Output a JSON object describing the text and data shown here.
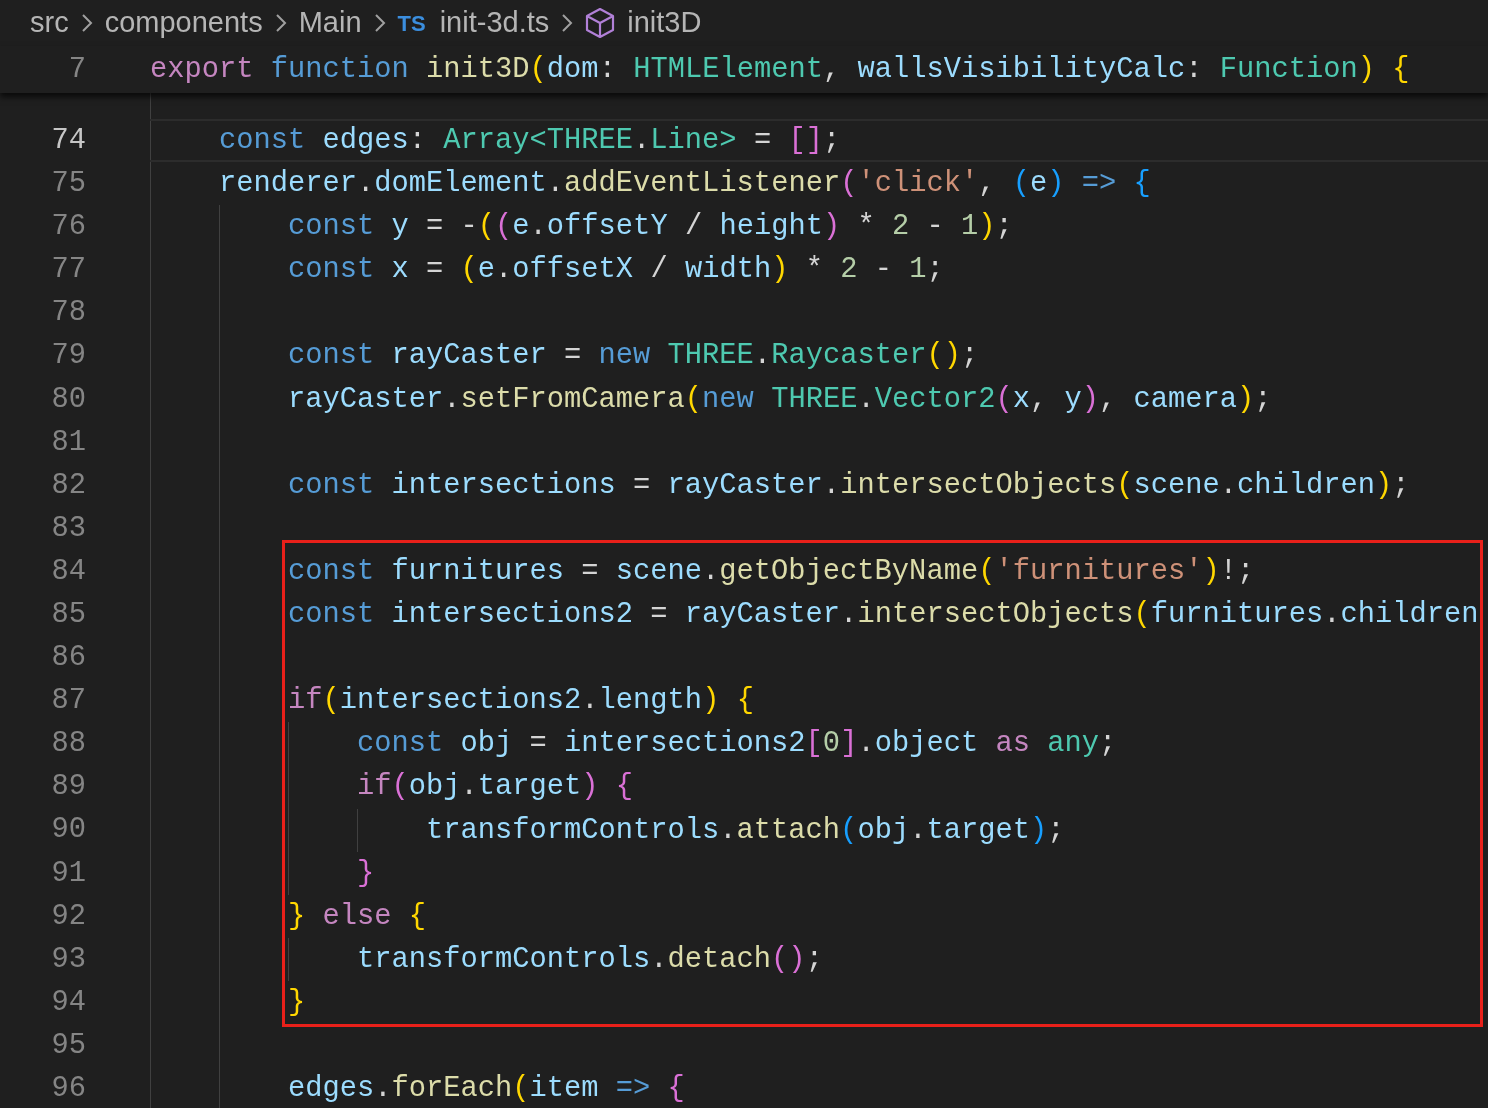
{
  "breadcrumb": [
    {
      "kind": "folder",
      "label": "src"
    },
    {
      "kind": "folder",
      "label": "components"
    },
    {
      "kind": "folder",
      "label": "Main"
    },
    {
      "kind": "ts-file",
      "badge": "TS",
      "label": "init-3d.ts"
    },
    {
      "kind": "symbol",
      "label": "init3D"
    }
  ],
  "sticky_line": {
    "number": "7",
    "tokens": [
      {
        "kind": "ctl",
        "text": "export"
      },
      {
        "kind": "kw",
        "text": " function"
      },
      {
        "kind": "fn",
        "text": " init3D"
      },
      {
        "kind": "b1",
        "text": "("
      },
      {
        "kind": "var",
        "text": "dom"
      },
      {
        "kind": "p",
        "text": ": "
      },
      {
        "kind": "type",
        "text": "HTMLElement"
      },
      {
        "kind": "p",
        "text": ", "
      },
      {
        "kind": "var",
        "text": "wallsVisibilityCalc"
      },
      {
        "kind": "p",
        "text": ": "
      },
      {
        "kind": "type",
        "text": "Function"
      },
      {
        "kind": "b1",
        "text": ")"
      },
      {
        "kind": "b1",
        "text": " {"
      }
    ]
  },
  "lines": [
    {
      "number": "74",
      "active": true,
      "tokens": [
        {
          "kind": "kw",
          "text": "const"
        },
        {
          "kind": "var",
          "text": " edges"
        },
        {
          "kind": "p",
          "text": ": "
        },
        {
          "kind": "type",
          "text": "Array<THREE"
        },
        {
          "kind": "p",
          "text": "."
        },
        {
          "kind": "type",
          "text": "Line>"
        },
        {
          "kind": "p",
          "text": " = "
        },
        {
          "kind": "b2",
          "text": "[]"
        },
        {
          "kind": "p",
          "text": ";"
        }
      ]
    },
    {
      "number": "75",
      "active": false,
      "tokens": [
        {
          "kind": "var",
          "text": "renderer"
        },
        {
          "kind": "p",
          "text": "."
        },
        {
          "kind": "var",
          "text": "domElement"
        },
        {
          "kind": "p",
          "text": "."
        },
        {
          "kind": "fn",
          "text": "addEventListener"
        },
        {
          "kind": "b2",
          "text": "("
        },
        {
          "kind": "str",
          "text": "'click'"
        },
        {
          "kind": "p",
          "text": ", "
        },
        {
          "kind": "b3",
          "text": "("
        },
        {
          "kind": "var",
          "text": "e"
        },
        {
          "kind": "b3",
          "text": ")"
        },
        {
          "kind": "kw",
          "text": " =>"
        },
        {
          "kind": "b3",
          "text": " {"
        }
      ],
      "children": [
        {
          "number": "76",
          "active": false,
          "tokens": [
            {
              "kind": "kw",
              "text": "const"
            },
            {
              "kind": "var",
              "text": " y"
            },
            {
              "kind": "p",
              "text": " = -"
            },
            {
              "kind": "b1",
              "text": "("
            },
            {
              "kind": "b2",
              "text": "("
            },
            {
              "kind": "var",
              "text": "e"
            },
            {
              "kind": "p",
              "text": "."
            },
            {
              "kind": "var",
              "text": "offsetY"
            },
            {
              "kind": "p",
              "text": " / "
            },
            {
              "kind": "var",
              "text": "height"
            },
            {
              "kind": "b2",
              "text": ")"
            },
            {
              "kind": "p",
              "text": " * "
            },
            {
              "kind": "num",
              "text": "2"
            },
            {
              "kind": "p",
              "text": " - "
            },
            {
              "kind": "num",
              "text": "1"
            },
            {
              "kind": "b1",
              "text": ")"
            },
            {
              "kind": "p",
              "text": ";"
            }
          ]
        },
        {
          "number": "77",
          "active": false,
          "tokens": [
            {
              "kind": "kw",
              "text": "const"
            },
            {
              "kind": "var",
              "text": " x"
            },
            {
              "kind": "p",
              "text": " = "
            },
            {
              "kind": "b1",
              "text": "("
            },
            {
              "kind": "var",
              "text": "e"
            },
            {
              "kind": "p",
              "text": "."
            },
            {
              "kind": "var",
              "text": "offsetX"
            },
            {
              "kind": "p",
              "text": " / "
            },
            {
              "kind": "var",
              "text": "width"
            },
            {
              "kind": "b1",
              "text": ")"
            },
            {
              "kind": "p",
              "text": " * "
            },
            {
              "kind": "num",
              "text": "2"
            },
            {
              "kind": "p",
              "text": " - "
            },
            {
              "kind": "num",
              "text": "1"
            },
            {
              "kind": "p",
              "text": ";"
            }
          ]
        },
        {
          "number": "78",
          "active": false
        },
        {
          "number": "79",
          "active": false,
          "tokens": [
            {
              "kind": "kw",
              "text": "const"
            },
            {
              "kind": "var",
              "text": " rayCaster"
            },
            {
              "kind": "p",
              "text": " = "
            },
            {
              "kind": "kw",
              "text": "new"
            },
            {
              "kind": "type",
              "text": " THREE"
            },
            {
              "kind": "p",
              "text": "."
            },
            {
              "kind": "type",
              "text": "Raycaster"
            },
            {
              "kind": "b1",
              "text": "()"
            },
            {
              "kind": "p",
              "text": ";"
            }
          ]
        },
        {
          "number": "80",
          "active": false,
          "tokens": [
            {
              "kind": "var",
              "text": "rayCaster"
            },
            {
              "kind": "p",
              "text": "."
            },
            {
              "kind": "fn",
              "text": "setFromCamera"
            },
            {
              "kind": "b1",
              "text": "("
            },
            {
              "kind": "kw",
              "text": "new"
            },
            {
              "kind": "type",
              "text": " THREE"
            },
            {
              "kind": "p",
              "text": "."
            },
            {
              "kind": "type",
              "text": "Vector2"
            },
            {
              "kind": "b2",
              "text": "("
            },
            {
              "kind": "var",
              "text": "x"
            },
            {
              "kind": "p",
              "text": ", "
            },
            {
              "kind": "var",
              "text": "y"
            },
            {
              "kind": "b2",
              "text": ")"
            },
            {
              "kind": "p",
              "text": ", "
            },
            {
              "kind": "var",
              "text": "camera"
            },
            {
              "kind": "b1",
              "text": ")"
            },
            {
              "kind": "p",
              "text": ";"
            }
          ]
        },
        {
          "number": "81",
          "active": false
        },
        {
          "number": "82",
          "active": false,
          "tokens": [
            {
              "kind": "kw",
              "text": "const"
            },
            {
              "kind": "var",
              "text": " intersections"
            },
            {
              "kind": "p",
              "text": " = "
            },
            {
              "kind": "var",
              "text": "rayCaster"
            },
            {
              "kind": "p",
              "text": "."
            },
            {
              "kind": "fn",
              "text": "intersectObjects"
            },
            {
              "kind": "b1",
              "text": "("
            },
            {
              "kind": "var",
              "text": "scene"
            },
            {
              "kind": "p",
              "text": "."
            },
            {
              "kind": "var",
              "text": "children"
            },
            {
              "kind": "b1",
              "text": ")"
            },
            {
              "kind": "p",
              "text": ";"
            }
          ]
        },
        {
          "number": "83",
          "active": false
        },
        {
          "number": "84",
          "active": false,
          "tokens": [
            {
              "kind": "kw",
              "text": "const"
            },
            {
              "kind": "var",
              "text": " furnitures"
            },
            {
              "kind": "p",
              "text": " = "
            },
            {
              "kind": "var",
              "text": "scene"
            },
            {
              "kind": "p",
              "text": "."
            },
            {
              "kind": "fn",
              "text": "getObjectByName"
            },
            {
              "kind": "b1",
              "text": "("
            },
            {
              "kind": "str",
              "text": "'furnitures'"
            },
            {
              "kind": "b1",
              "text": ")"
            },
            {
              "kind": "p",
              "text": "!;"
            }
          ]
        },
        {
          "number": "85",
          "active": false,
          "tokens": [
            {
              "kind": "kw",
              "text": "const"
            },
            {
              "kind": "var",
              "text": " intersections2"
            },
            {
              "kind": "p",
              "text": " = "
            },
            {
              "kind": "var",
              "text": "rayCaster"
            },
            {
              "kind": "p",
              "text": "."
            },
            {
              "kind": "fn",
              "text": "intersectObjects"
            },
            {
              "kind": "b1",
              "text": "("
            },
            {
              "kind": "var",
              "text": "furnitures"
            },
            {
              "kind": "p",
              "text": "."
            },
            {
              "kind": "var",
              "text": "children"
            }
          ]
        },
        {
          "number": "86",
          "active": false
        },
        {
          "number": "87",
          "active": false,
          "tokens": [
            {
              "kind": "ctl",
              "text": "if"
            },
            {
              "kind": "b1",
              "text": "("
            },
            {
              "kind": "var",
              "text": "intersections2"
            },
            {
              "kind": "p",
              "text": "."
            },
            {
              "kind": "var",
              "text": "length"
            },
            {
              "kind": "b1",
              "text": ")"
            },
            {
              "kind": "b1",
              "text": " {"
            }
          ],
          "children": [
            {
              "number": "88",
              "active": false,
              "tokens": [
                {
                  "kind": "kw",
                  "text": "const"
                },
                {
                  "kind": "var",
                  "text": " obj"
                },
                {
                  "kind": "p",
                  "text": " = "
                },
                {
                  "kind": "var",
                  "text": "intersections2"
                },
                {
                  "kind": "b2",
                  "text": "["
                },
                {
                  "kind": "num",
                  "text": "0"
                },
                {
                  "kind": "b2",
                  "text": "]"
                },
                {
                  "kind": "p",
                  "text": "."
                },
                {
                  "kind": "var",
                  "text": "object"
                },
                {
                  "kind": "ctl",
                  "text": " as"
                },
                {
                  "kind": "type",
                  "text": " any"
                },
                {
                  "kind": "p",
                  "text": ";"
                }
              ]
            },
            {
              "number": "89",
              "active": false,
              "tokens": [
                {
                  "kind": "ctl",
                  "text": "if"
                },
                {
                  "kind": "b2",
                  "text": "("
                },
                {
                  "kind": "var",
                  "text": "obj"
                },
                {
                  "kind": "p",
                  "text": "."
                },
                {
                  "kind": "var",
                  "text": "target"
                },
                {
                  "kind": "b2",
                  "text": ")"
                },
                {
                  "kind": "b2",
                  "text": " {"
                }
              ],
              "children": [
                {
                  "number": "90",
                  "active": false,
                  "tokens": [
                    {
                      "kind": "var",
                      "text": "transformControls"
                    },
                    {
                      "kind": "p",
                      "text": "."
                    },
                    {
                      "kind": "fn",
                      "text": "attach"
                    },
                    {
                      "kind": "b3",
                      "text": "("
                    },
                    {
                      "kind": "var",
                      "text": "obj"
                    },
                    {
                      "kind": "p",
                      "text": "."
                    },
                    {
                      "kind": "var",
                      "text": "target"
                    },
                    {
                      "kind": "b3",
                      "text": ")"
                    },
                    {
                      "kind": "p",
                      "text": ";"
                    }
                  ]
                }
              ]
            },
            {
              "number": "91",
              "active": false,
              "tokens": [
                {
                  "kind": "b2",
                  "text": "}"
                }
              ]
            }
          ]
        },
        {
          "number": "92",
          "active": false,
          "tokens": [
            {
              "kind": "b1",
              "text": "}"
            },
            {
              "kind": "ctl",
              "text": " else"
            },
            {
              "kind": "b1",
              "text": " {"
            }
          ],
          "children": [
            {
              "number": "93",
              "active": false,
              "tokens": [
                {
                  "kind": "var",
                  "text": "transformControls"
                },
                {
                  "kind": "p",
                  "text": "."
                },
                {
                  "kind": "fn",
                  "text": "detach"
                },
                {
                  "kind": "b2",
                  "text": "()"
                },
                {
                  "kind": "p",
                  "text": ";"
                }
              ]
            }
          ]
        },
        {
          "number": "94",
          "active": false,
          "tokens": [
            {
              "kind": "b1",
              "text": "}"
            }
          ]
        },
        {
          "number": "95",
          "active": false
        },
        {
          "number": "96",
          "active": false,
          "tokens": [
            {
              "kind": "var",
              "text": "edges"
            },
            {
              "kind": "p",
              "text": "."
            },
            {
              "kind": "fn",
              "text": "forEach"
            },
            {
              "kind": "b1",
              "text": "("
            },
            {
              "kind": "var",
              "text": "item"
            },
            {
              "kind": "kw",
              "text": " =>"
            },
            {
              "kind": "b2",
              "text": " {"
            }
          ]
        }
      ]
    }
  ]
}
